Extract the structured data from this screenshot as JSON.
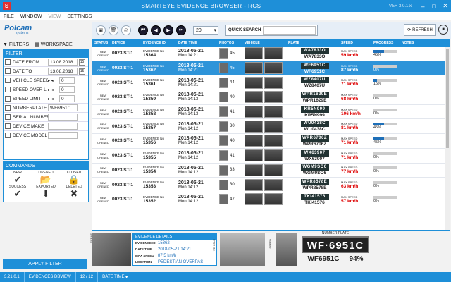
{
  "window": {
    "title": "SMARTEYE EVIDENCE BROWSER - RCS",
    "version": "VER 3.0.1.x",
    "app_icon": "S"
  },
  "menu": [
    "FILE",
    "WINDOW",
    "VIEW",
    "SETTINGS"
  ],
  "brand": {
    "logo": "Polcam",
    "sub": "systems"
  },
  "toolbar": {
    "page_size": "20",
    "quick_search_label": "QUICK SEARCH",
    "refresh_label": "REFRESH"
  },
  "left": {
    "filters_label": "FILTERS",
    "workspace_label": "WORKSPACE",
    "filter_title": "FILTER",
    "commands_title": "COMMANDS",
    "apply_label": "APPLY FILTER"
  },
  "filter_rows": [
    {
      "label": "DATE FROM",
      "value": "13.08.2018"
    },
    {
      "label": "DATE TO",
      "value": "13.08.2018"
    },
    {
      "label": "VEHICLE SPEED",
      "value": "0"
    },
    {
      "label": "SPEED OVER LIMI",
      "value": "0"
    },
    {
      "label": "SPEED LIMIT",
      "value": "0"
    },
    {
      "label": "NUMBERPLATE",
      "value": "WF6951C"
    },
    {
      "label": "SERIAL NUMBER",
      "value": ""
    },
    {
      "label": "DEVICE MAKE",
      "value": ""
    },
    {
      "label": "DEVICE MODEL",
      "value": ""
    }
  ],
  "commands": {
    "new": "NEW",
    "opened": "OPENED",
    "closed": "CLOSED",
    "success": "SUCCESS",
    "exported": "EXPORTED",
    "deleted": "DELETED"
  },
  "grid": {
    "headers": {
      "status": "STATUS",
      "device": "DEVICE",
      "evidence_id": "EVIDENCE ID",
      "date_time": "DATE TIME",
      "photos": "PHOTOS",
      "vehicle": "VEHICLE",
      "plate": "PLATE",
      "speed": "SPEED",
      "progress": "PROGRESS",
      "notes": "NOTES"
    },
    "status_new": "NEW",
    "status_opened": "OPENED",
    "ev_label": "EVIDENCE No",
    "date_label": "DATE",
    "time_label": "TIME",
    "maxspeed_label": "MAX SPEED",
    "rows": [
      {
        "device": "0023.ST-1",
        "id": "15364",
        "date": "2018-05-21",
        "time": "Mon 14:21",
        "photos": "45",
        "plate": "WA7833O",
        "speed": "59 km/h",
        "progress": "45%",
        "selected": false
      },
      {
        "device": "0023.ST-1",
        "id": "15362",
        "date": "2018-05-21",
        "time": "Mon 14:21",
        "photos": "45",
        "plate": "WF6951C",
        "speed": "87 km/h",
        "progress": "0%",
        "selected": true
      },
      {
        "device": "0023.ST-1",
        "id": "15361",
        "date": "2018-05-21",
        "time": "Mon 14:21",
        "photos": "44",
        "plate": "WZ8407U",
        "speed": "71 km/h",
        "progress": "15%",
        "selected": false
      },
      {
        "device": "0023.ST-1",
        "id": "15359",
        "date": "2018-05-21",
        "time": "Mon 14:13",
        "photos": "40",
        "plate": "WPR1629E",
        "speed": "68 km/h",
        "progress": "0%",
        "selected": false
      },
      {
        "device": "0023.ST-1",
        "id": "15358",
        "date": "2018-05-21",
        "time": "Mon 14:13",
        "photos": "41",
        "plate": "KR5N999",
        "speed": "106 km/h",
        "progress": "0%",
        "selected": false
      },
      {
        "device": "0023.ST-1",
        "id": "15357",
        "date": "2018-05-21",
        "time": "Mon 14:12",
        "photos": "30",
        "plate": "WU0438C",
        "speed": "81 km/h",
        "progress": "45%",
        "selected": false
      },
      {
        "device": "0023.ST-1",
        "id": "15356",
        "date": "2018-05-21",
        "time": "Mon 14:12",
        "photos": "40",
        "plate": "WPR6706Z",
        "speed": "71 km/h",
        "progress": "45%",
        "selected": false
      },
      {
        "device": "0023.ST-1",
        "id": "15355",
        "date": "2018-05-21",
        "time": "Mon 14:12",
        "photos": "41",
        "plate": "WX63907",
        "speed": "71 km/h",
        "progress": "0%",
        "selected": false
      },
      {
        "device": "0023.ST-1",
        "id": "15354",
        "date": "2018-05-21",
        "time": "Mon 14:12",
        "photos": "33",
        "plate": "WGM9SO6",
        "speed": "77 km/h",
        "progress": "0%",
        "selected": false
      },
      {
        "device": "0023.ST-1",
        "id": "15353",
        "date": "2018-05-21",
        "time": "Mon 14:12",
        "photos": "30",
        "plate": "WPR8578E",
        "speed": "63 km/h",
        "progress": "0%",
        "selected": false
      },
      {
        "device": "0023.ST-1",
        "id": "15352",
        "date": "2018-05-21",
        "time": "Mon 14:12",
        "photos": "47",
        "plate": "TKI41576",
        "speed": "57 km/h",
        "progress": "0%",
        "selected": false
      }
    ]
  },
  "details": {
    "title": "EVIDENCE DETAILS",
    "scene_label": "SCENE",
    "vehicle_label": "VEHICLE",
    "speed_label": "SPEED",
    "rows": [
      {
        "k": "EVIDENCE ID",
        "v": "15362"
      },
      {
        "k": "DATE/TIME",
        "v": "2018-05-21 14:21"
      },
      {
        "k": "MAX SPEED",
        "v": "87,5 km/h"
      },
      {
        "k": "LOCATION",
        "v": "PEDESTIAN OVERPAS"
      }
    ],
    "numberplate_label": "NUMBER PLATE",
    "plate": "WF·6951C",
    "plate_text": "WF6951C",
    "confidence": "94%"
  },
  "status_bar": [
    "3.21.0.1",
    "EVIDENCES DBVIEW",
    "12 / 12",
    "DATE TIME"
  ],
  "colors": {
    "accent": "#1e8fd8",
    "selected_row": "#2e94d9",
    "speed_red": "#dd0000"
  }
}
